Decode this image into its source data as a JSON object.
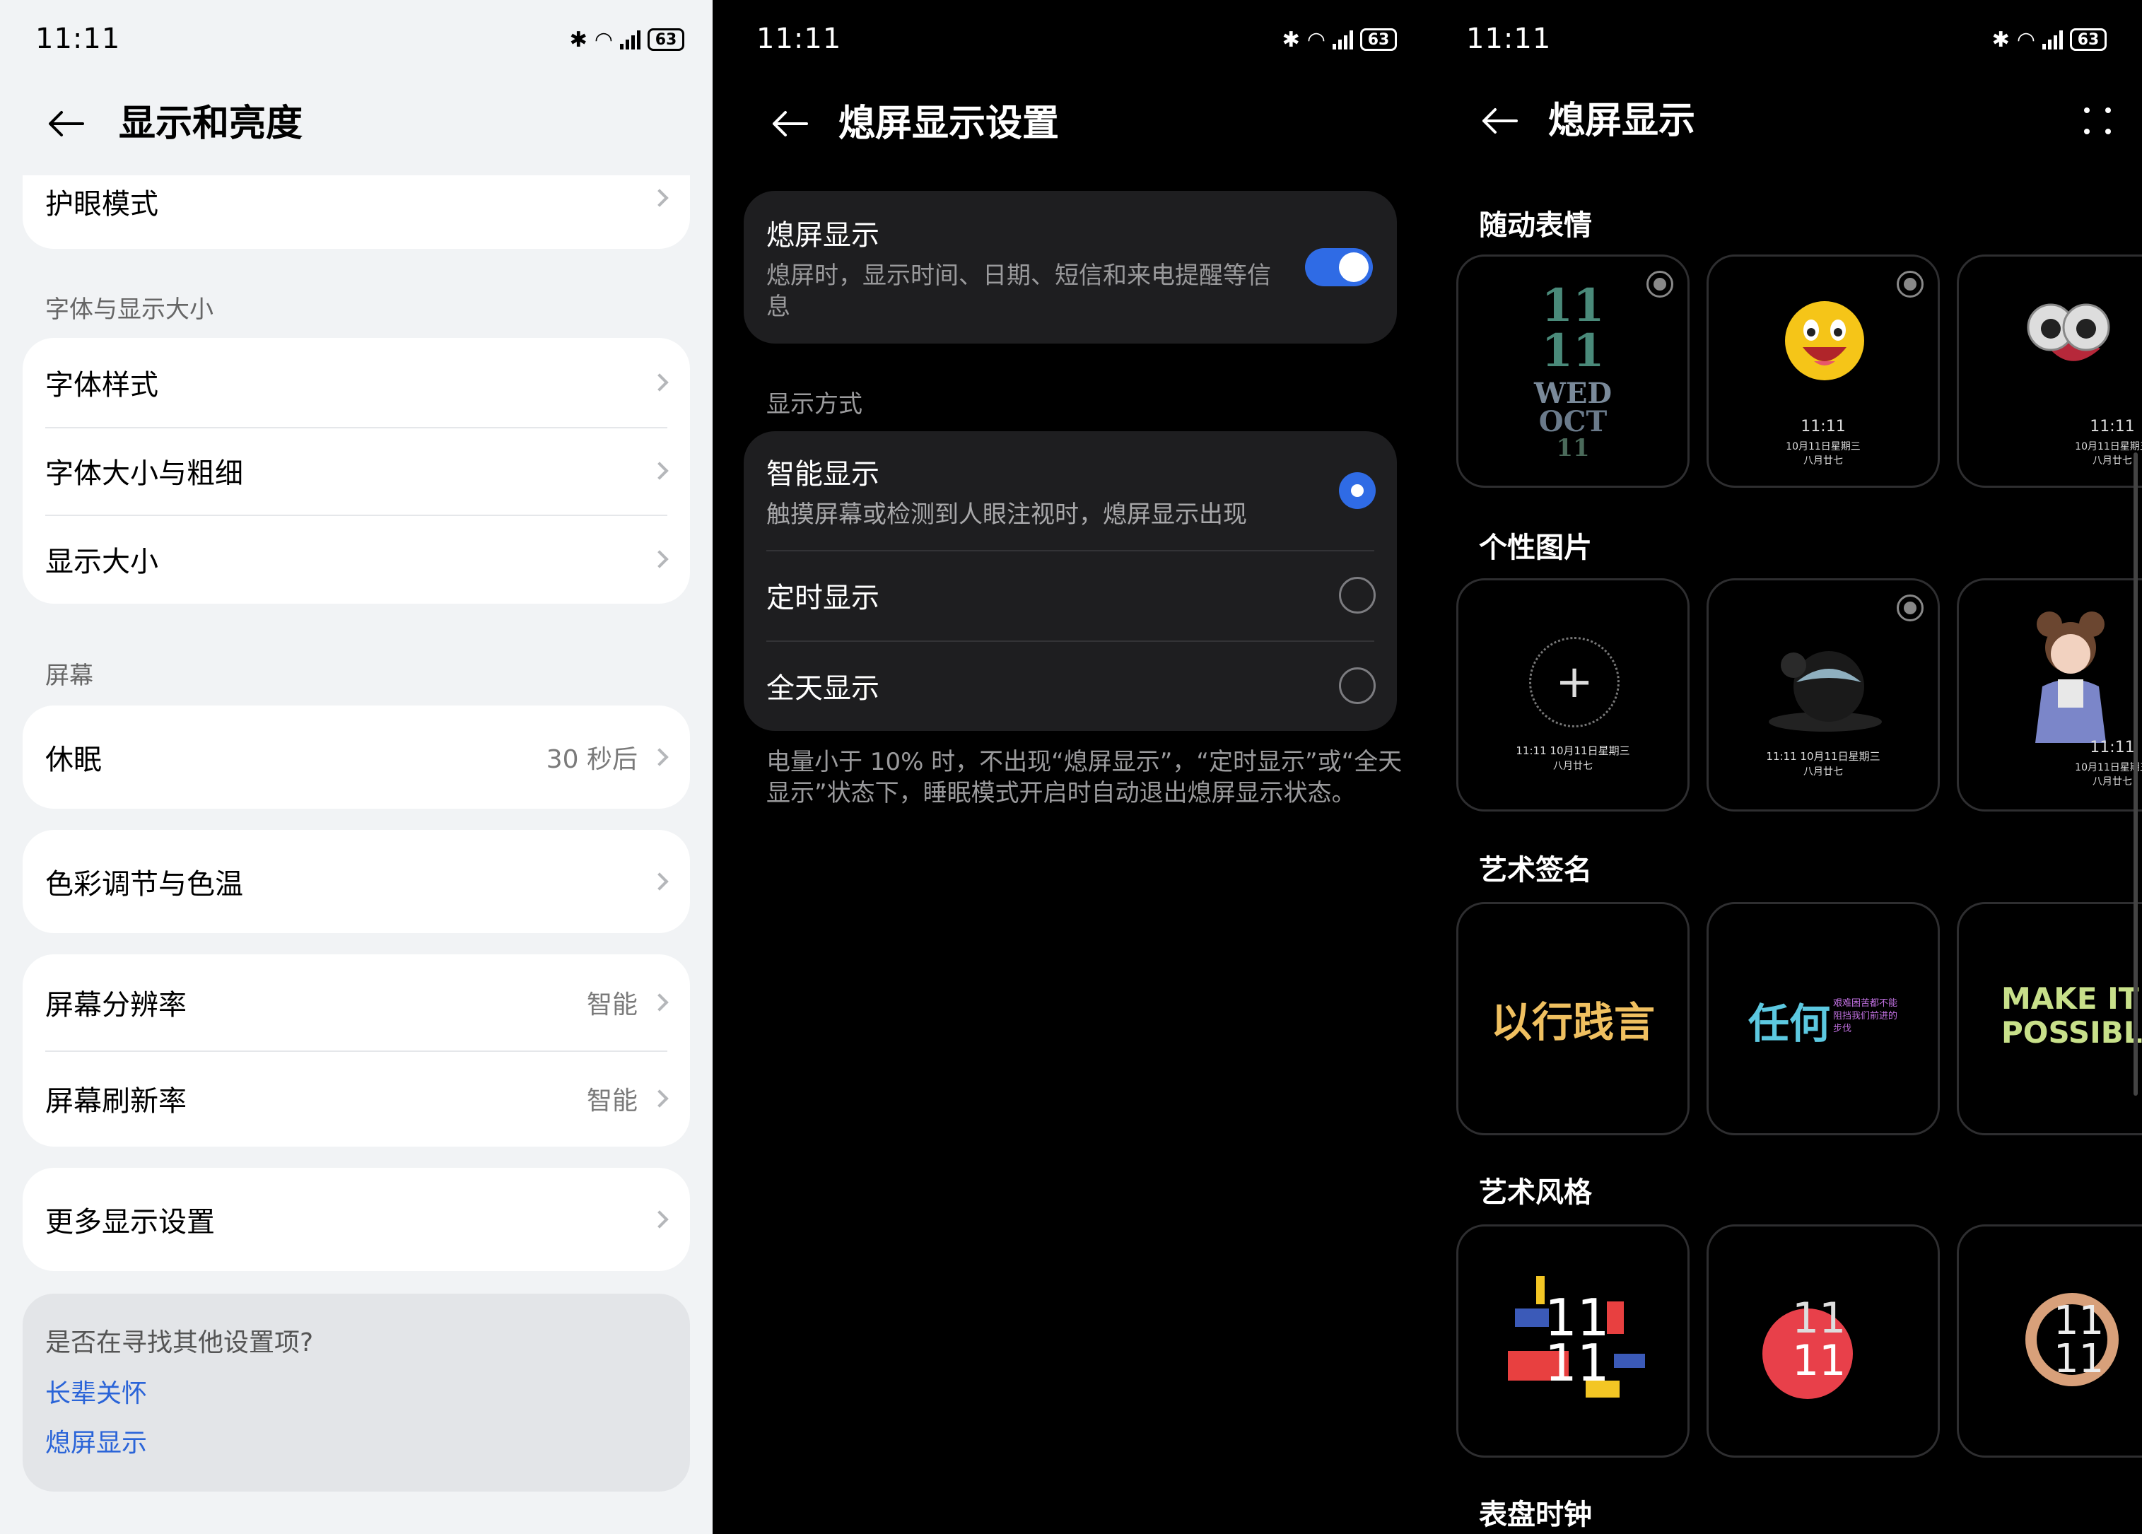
{
  "status": {
    "time": "11:11",
    "battery": "63"
  },
  "p1": {
    "title": "显示和亮度",
    "eye_comfort": "护眼模式",
    "font_section": "字体与显示大小",
    "font_style": "字体样式",
    "font_size_weight": "字体大小与粗细",
    "display_size": "显示大小",
    "screen_section": "屏幕",
    "sleep": "休眠",
    "sleep_value": "30 秒后",
    "color": "色彩调节与色温",
    "resolution": "屏幕分辨率",
    "resolution_value": "智能",
    "refresh": "屏幕刷新率",
    "refresh_value": "智能",
    "more": "更多显示设置",
    "suggest_title": "是否在寻找其他设置项?",
    "suggest_link1": "长辈关怀",
    "suggest_link2": "熄屏显示"
  },
  "p2": {
    "title": "熄屏显示设置",
    "aod_title": "熄屏显示",
    "aod_desc": "熄屏时，显示时间、日期、短信和来电提醒等信息",
    "aod_enabled": true,
    "mode_section": "显示方式",
    "smart": "智能显示",
    "smart_desc": "触摸屏幕或检测到人眼注视时，熄屏显示出现",
    "scheduled": "定时显示",
    "allday": "全天显示",
    "selected_mode": "智能显示",
    "note": "电量小于 10% 时，不出现“熄屏显示”，“定时显示”或“全天显示”状态下，睡眠模式开启时自动退出熄屏显示状态。"
  },
  "p3": {
    "title": "熄屏显示",
    "cat1": "随动表情",
    "cat2": "个性图片",
    "cat3": "艺术签名",
    "cat4": "艺术风格",
    "cat5": "表盘时钟",
    "t1_lines": [
      "11",
      "11",
      "WED",
      "OCT",
      "11"
    ],
    "clock_small": "11:11",
    "date_small": "10月11日星期三",
    "lunar_small": "八月廿七",
    "inline_time_date": "11:11  10月11日星期三",
    "sig1": "以行践言",
    "sig2": "任何",
    "sig2_small": "艰难困苦都不能阻挡我们前进的步伐",
    "sig3a": "MAKE IT",
    "sig3b": "POSSIBLE",
    "art_digits": "11"
  },
  "colors": {
    "accent": "#2f6be5",
    "link": "#2a64d8"
  }
}
